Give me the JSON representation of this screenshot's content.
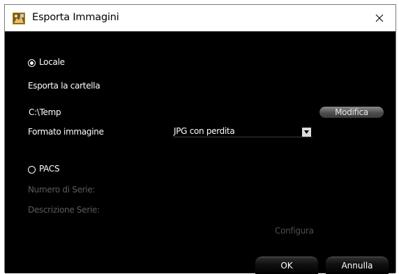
{
  "window": {
    "title": "Esporta Immagini",
    "close_glyph": "✕"
  },
  "local": {
    "radio_label": "Locale",
    "selected": true,
    "folder_label": "Esporta la cartella",
    "folder_path": "C:\\Temp",
    "modify_button": "Modifica",
    "format_label": "Formato immagine",
    "format_value": "JPG con perdita"
  },
  "pacs": {
    "radio_label": "PACS",
    "selected": false,
    "series_number_label": "Numero di Serie:",
    "series_desc_label": "Descrizione Serie:",
    "configure_button": "Configura"
  },
  "actions": {
    "ok_label": "OK",
    "cancel_label": "Annulla"
  },
  "colors": {
    "background": "#000000",
    "text": "#ffffff",
    "disabled_text": "#5c5c5c"
  }
}
